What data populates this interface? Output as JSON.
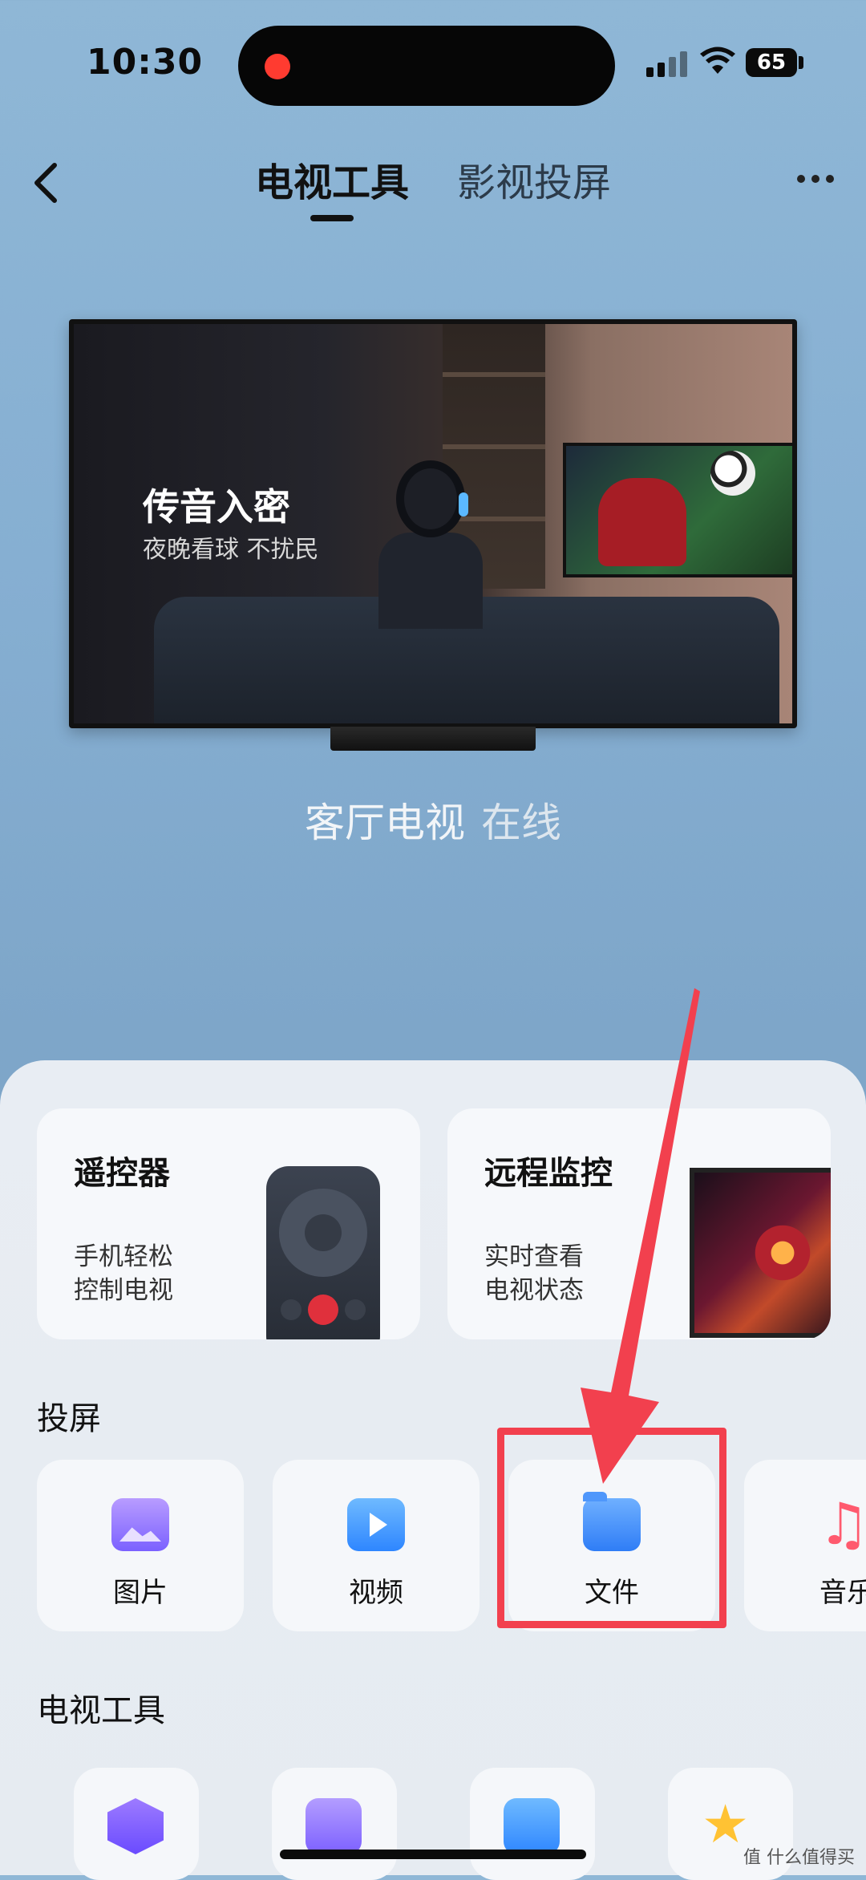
{
  "status_bar": {
    "time": "10:30",
    "battery": "65"
  },
  "header": {
    "tabs": [
      {
        "label": "电视工具",
        "active": true
      },
      {
        "label": "影视投屏",
        "active": false
      }
    ]
  },
  "banner": {
    "title": "传音入密",
    "subtitle": "夜晚看球 不扰民"
  },
  "device": {
    "name": "客厅电视",
    "status": "在线"
  },
  "feature_cards": [
    {
      "title": "遥控器",
      "desc_line1": "手机轻松",
      "desc_line2": "控制电视",
      "icon": "remote-icon"
    },
    {
      "title": "远程监控",
      "desc_line1": "实时查看",
      "desc_line2": "电视状态",
      "icon": "monitor-icon"
    }
  ],
  "cast_section": {
    "title": "投屏",
    "items": [
      {
        "label": "图片",
        "icon": "photo-icon"
      },
      {
        "label": "视频",
        "icon": "video-icon"
      },
      {
        "label": "文件",
        "icon": "folder-icon"
      },
      {
        "label": "音乐",
        "icon": "music-icon"
      }
    ]
  },
  "tools_section": {
    "title": "电视工具",
    "items": [
      {
        "icon": "voice-icon"
      },
      {
        "icon": "screenshot-icon"
      },
      {
        "icon": "camera-icon"
      },
      {
        "icon": "magic-icon"
      }
    ]
  },
  "watermark": "值 什么值得买",
  "colors": {
    "annotation_red": "#f2404e",
    "accent_blue": "#2f7df6"
  }
}
